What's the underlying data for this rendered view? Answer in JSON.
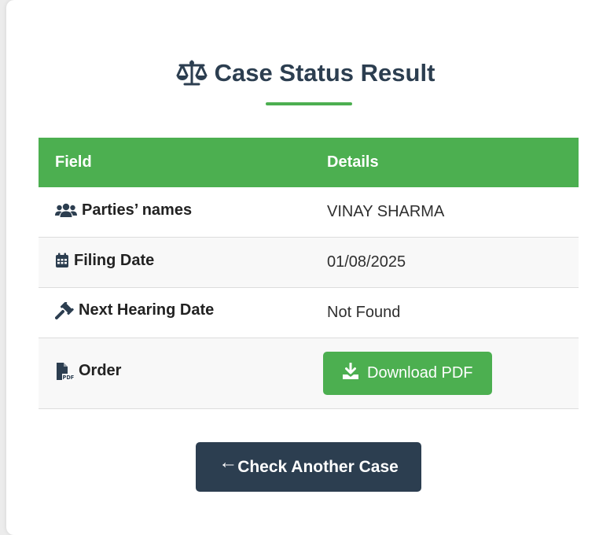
{
  "page": {
    "title": "Case Status Result",
    "title_icon": "scale-balance-icon",
    "accent_color": "#4caf50",
    "dark_color": "#2c3e50"
  },
  "table": {
    "headers": [
      "Field",
      "Details"
    ],
    "rows": [
      {
        "icon": "users-icon",
        "label": "Parties’ names",
        "value": "VINAY SHARMA"
      },
      {
        "icon": "calendar-icon",
        "label": "Filing Date",
        "value": "01/08/2025"
      },
      {
        "icon": "gavel-icon",
        "label": "Next Hearing Date",
        "value": "Not Found"
      },
      {
        "icon": "pdf-file-icon",
        "label": "Order",
        "value": ""
      }
    ]
  },
  "download_button": {
    "label": "Download PDF",
    "icon": "download-icon"
  },
  "back_button": {
    "label": "Check Another Case",
    "arrow": "←",
    "icon": "arrow-left-icon"
  }
}
